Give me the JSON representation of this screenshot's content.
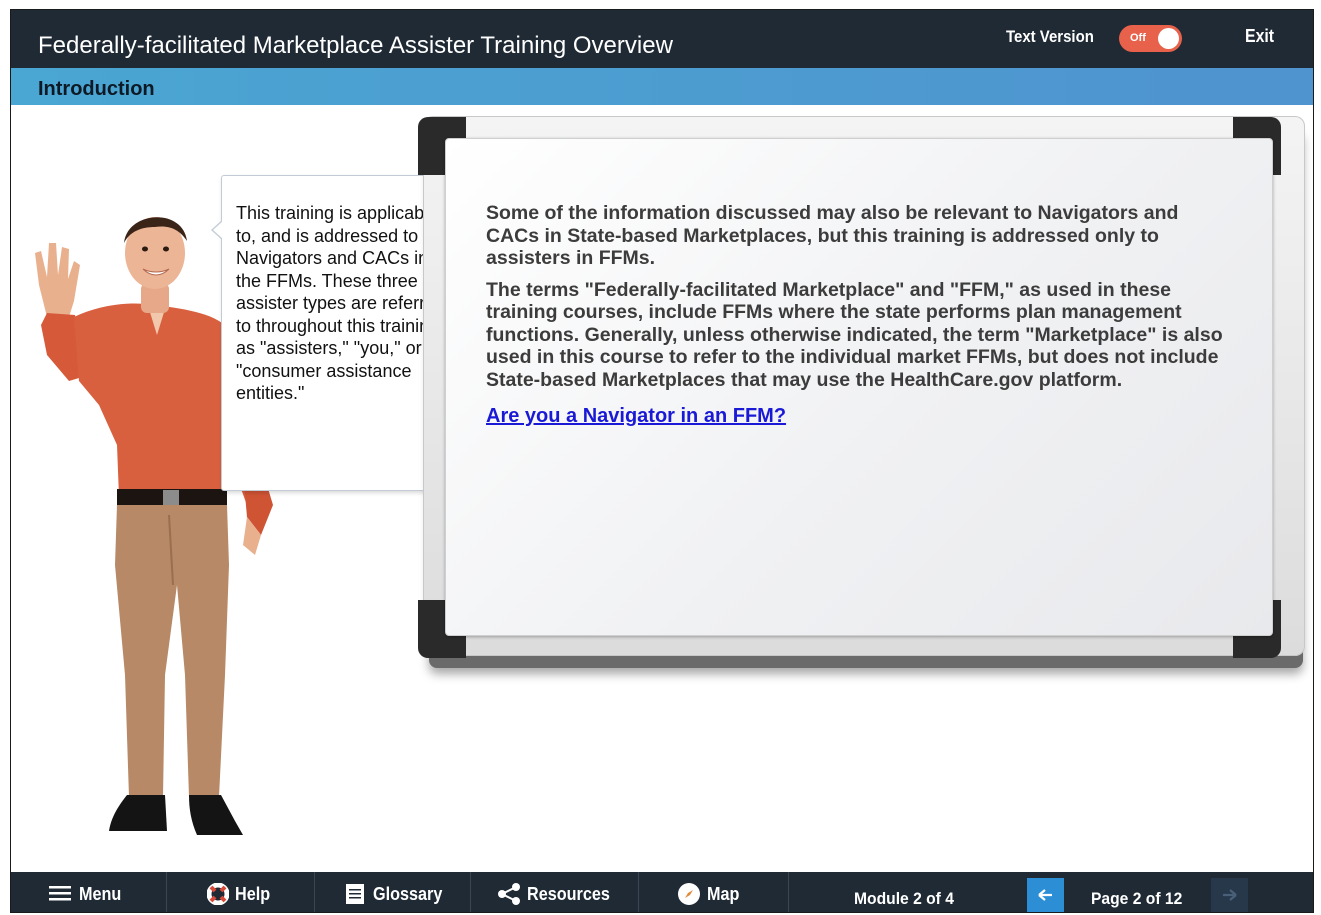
{
  "header": {
    "title": "Federally-facilitated Marketplace Assister Training Overview",
    "text_version_label": "Text Version",
    "toggle_state": "Off",
    "exit_label": "Exit"
  },
  "section": {
    "title": "Introduction"
  },
  "bubble": {
    "text": "This training is applicable to, and is addressed to Navigators and CACs in the FFMs. These three assister types are referred to throughout this training as \"assisters,\" \"you,\" or \"consumer assistance entities.\""
  },
  "board": {
    "paragraph_1": "Some of the information discussed may also be relevant to Navigators and CACs in State-based Marketplaces, but this training is addressed only to assisters in FFMs.",
    "paragraph_2": "The terms \"Federally-facilitated Marketplace\" and \"FFM,\" as used in these training courses, include FFMs where the state performs plan management functions. Generally, unless otherwise indicated, the term \"Marketplace\" is also used in this course to refer to the individual market FFMs, but does not include State-based Marketplaces that may use the HealthCare.gov platform.",
    "link": "Are you a Navigator in an FFM?"
  },
  "footer": {
    "menu_label": "Menu",
    "help_label": "Help",
    "glossary_label": "Glossary",
    "resources_label": "Resources",
    "map_label": "Map",
    "module_info": "Module 2 of 4",
    "page_info": "Page 2 of 12"
  },
  "colors": {
    "header_bg": "#1f2a35",
    "section_bar": "#4aa6d2",
    "toggle_off": "#e8614a",
    "link": "#1a1ad6",
    "prev_button": "#2c8fd6"
  }
}
